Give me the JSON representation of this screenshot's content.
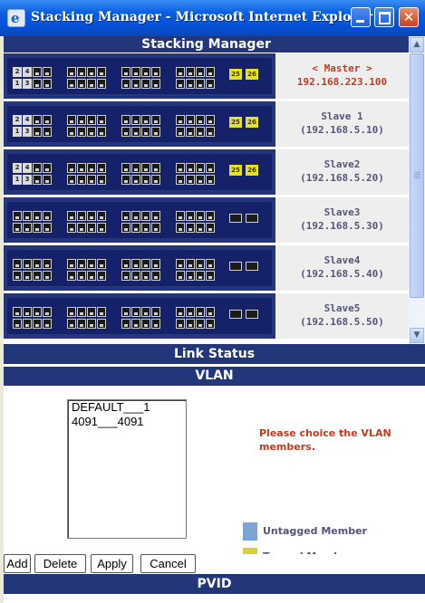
{
  "window": {
    "title": "Stacking Manager - Microsoft Internet Explorer"
  },
  "stacking": {
    "header": "Stacking Manager",
    "units": [
      {
        "role": "< Master >",
        "ip": "192.168.223.100",
        "style": "master",
        "sfp": [
          "25",
          "26"
        ]
      },
      {
        "role": "Slave 1",
        "ip": "(192.168.5.10)",
        "style": "slave",
        "sfp": [
          "25",
          "26"
        ]
      },
      {
        "role": "Slave2",
        "ip": "(192.168.5.20)",
        "style": "slave",
        "sfp": [
          "25",
          "26"
        ]
      },
      {
        "role": "Slave3",
        "ip": "(192.168.5.30)",
        "style": "slave",
        "sfp": []
      },
      {
        "role": "Slave4",
        "ip": "(192.168.5.40)",
        "style": "slave",
        "sfp": []
      },
      {
        "role": "Slave5",
        "ip": "(192.168.5.50)",
        "style": "slave",
        "sfp": []
      }
    ],
    "port_labels": {
      "top": [
        "2",
        "4"
      ],
      "bottom": [
        "1",
        "3"
      ]
    }
  },
  "link_status": {
    "label": "Link Status"
  },
  "vlan": {
    "header": "VLAN",
    "list": [
      "DEFAULT___1",
      "4091___4091"
    ],
    "hint": "Please choice the VLAN members.",
    "legend": {
      "untagged": "Untagged Member",
      "tagged": "Tagged Member"
    },
    "colors": {
      "untagged": "#7ba3d6",
      "tagged": "#d8d23a"
    }
  },
  "buttons": {
    "add": "Add",
    "delete": "Delete",
    "apply": "Apply",
    "cancel": "Cancel"
  },
  "pvid": {
    "label": "PVID"
  }
}
